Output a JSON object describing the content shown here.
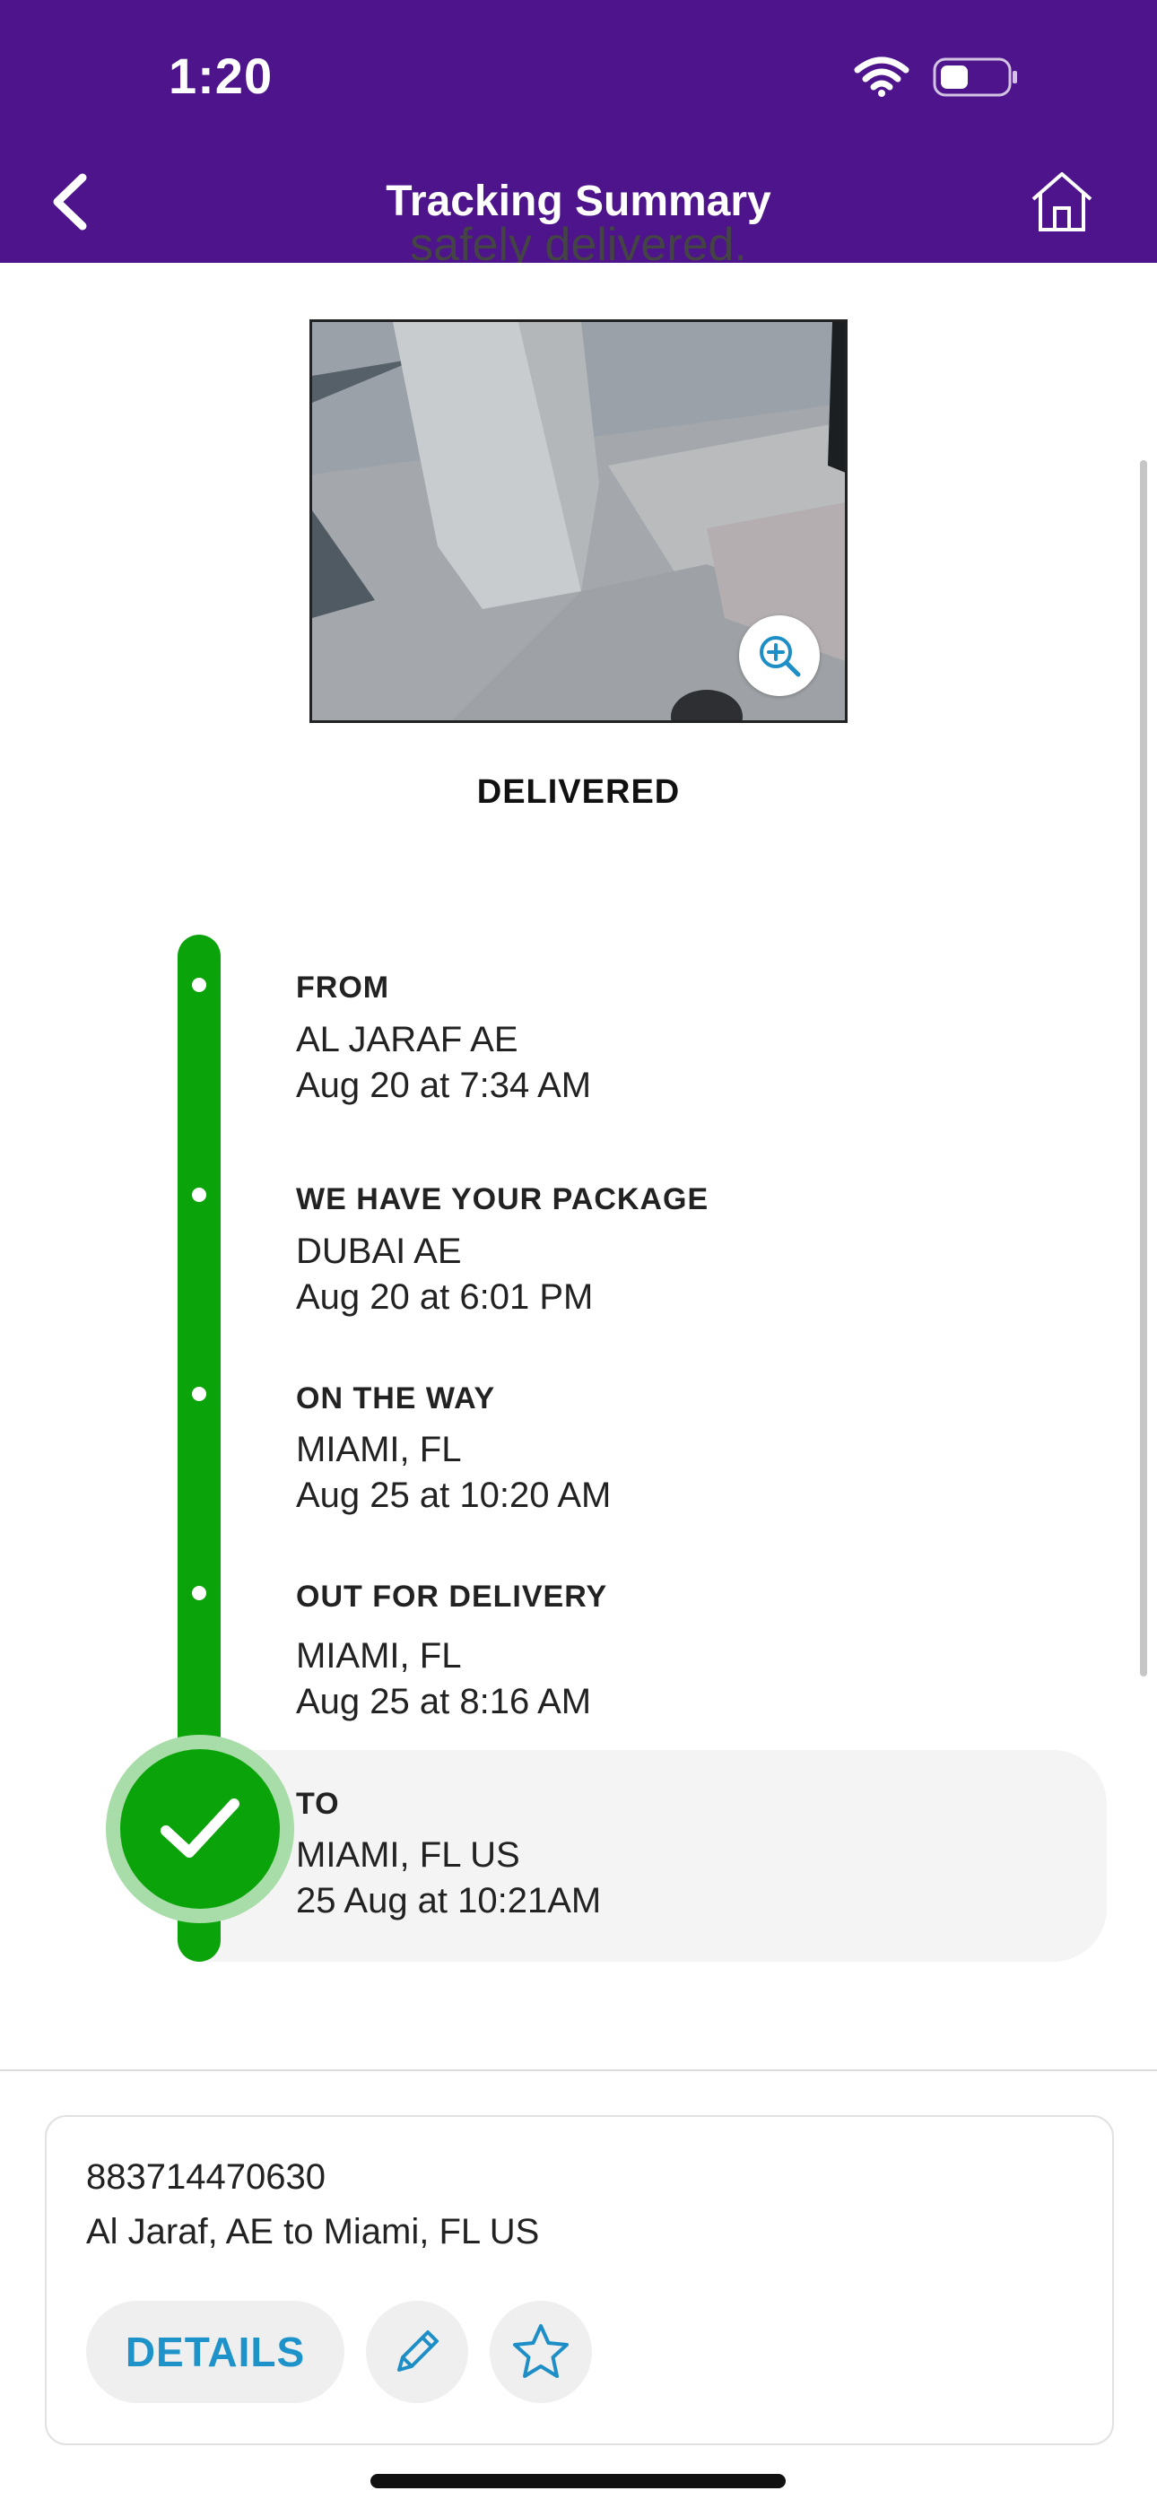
{
  "status_bar": {
    "time": "1:20"
  },
  "nav": {
    "title": "Tracking Summary"
  },
  "content": {
    "cut_off_text": "safely delivered.",
    "delivery_status": "DELIVERED"
  },
  "timeline": [
    {
      "title": "FROM",
      "location": "AL JARAF AE",
      "time": "Aug 20 at 7:34 AM"
    },
    {
      "title": "WE HAVE YOUR PACKAGE",
      "location": "DUBAI AE",
      "time": "Aug 20 at 6:01 PM"
    },
    {
      "title": "ON THE WAY",
      "location": "MIAMI, FL",
      "time": "Aug 25 at 10:20 AM"
    },
    {
      "title": "OUT FOR DELIVERY",
      "location": "MIAMI, FL",
      "time": "Aug 25 at 8:16 AM"
    },
    {
      "title": "TO",
      "location": "MIAMI, FL US",
      "time": "25 Aug at 10:21AM"
    }
  ],
  "card": {
    "tracking_number": "883714470630",
    "route": "Al Jaraf, AE to Miami, FL US",
    "details_label": "DETAILS"
  },
  "colors": {
    "brand_purple": "#4d148c",
    "success_green": "#0aa30a",
    "link_blue": "#1e93c9"
  },
  "icons": {
    "back": "chevron-left-icon",
    "home": "home-icon",
    "zoom": "zoom-in-icon",
    "edit": "pencil-icon",
    "favorite": "star-icon",
    "check": "check-icon"
  }
}
